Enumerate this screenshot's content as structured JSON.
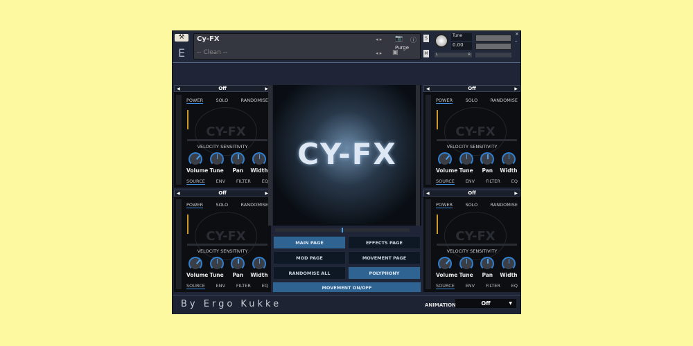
{
  "header": {
    "instrument_name": "Cy-FX",
    "snapshot": "-- Clean --",
    "purge_label": "Purge",
    "solo_label": "S",
    "mute_label": "M",
    "tune_label": "Tune",
    "tune_value": "0.00",
    "pan_left": "L",
    "pan_right": "R",
    "close": "×",
    "minimize": "–"
  },
  "slots": [
    {
      "preset": "Off",
      "tabs": [
        "POWER",
        "SOLO",
        "RANDOMISE"
      ],
      "velocity_label": "VELOCITY SENSITIVITY",
      "knobs": [
        "Volume",
        "Tune",
        "Pan",
        "Width"
      ],
      "bottom_tabs": [
        "SOURCE",
        "ENV",
        "FILTER",
        "EQ"
      ],
      "watermark": "CY-FX"
    },
    {
      "preset": "Off",
      "tabs": [
        "POWER",
        "SOLO",
        "RANDOMISE"
      ],
      "velocity_label": "VELOCITY SENSITIVITY",
      "knobs": [
        "Volume",
        "Tune",
        "Pan",
        "Width"
      ],
      "bottom_tabs": [
        "SOURCE",
        "ENV",
        "FILTER",
        "EQ"
      ],
      "watermark": "CY-FX"
    },
    {
      "preset": "Off",
      "tabs": [
        "POWER",
        "SOLO",
        "RANDOMISE"
      ],
      "velocity_label": "VELOCITY SENSITIVITY",
      "knobs": [
        "Volume",
        "Tune",
        "Pan",
        "Width"
      ],
      "bottom_tabs": [
        "SOURCE",
        "ENV",
        "FILTER",
        "EQ"
      ],
      "watermark": "CY-FX"
    },
    {
      "preset": "Off",
      "tabs": [
        "POWER",
        "SOLO",
        "RANDOMISE"
      ],
      "velocity_label": "VELOCITY SENSITIVITY",
      "knobs": [
        "Volume",
        "Tune",
        "Pan",
        "Width"
      ],
      "bottom_tabs": [
        "SOURCE",
        "ENV",
        "FILTER",
        "EQ"
      ],
      "watermark": "CY-FX"
    }
  ],
  "artwork_title": "CY-FX",
  "buttons": {
    "main_page": "MAIN PAGE",
    "effects_page": "EFFECTS PAGE",
    "mod_page": "MOD PAGE",
    "movement_page": "MOVEMENT PAGE",
    "randomise_all": "RANDOMISE ALL",
    "polyphony": "POLYPHONY",
    "movement_onoff": "MOVEMENT ON/OFF"
  },
  "footer": {
    "credit": "By Ergo Kukke",
    "animation_label": "ANIMATION",
    "animation_value": "Off"
  },
  "colors": {
    "accent": "#2e6392",
    "knob_ring": "#2f7fd0",
    "background": "#fcf9a0"
  }
}
